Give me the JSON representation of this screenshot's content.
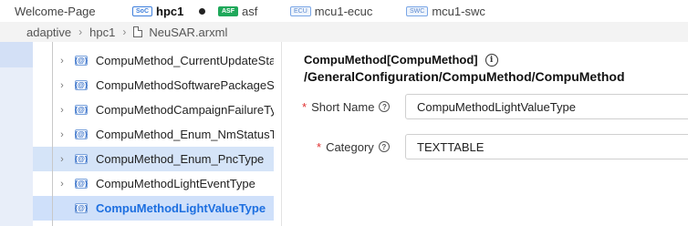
{
  "tabs": [
    {
      "label": "Welcome-Page",
      "badge": "",
      "active": false
    },
    {
      "label": "hpc1",
      "badge": "SoC",
      "active": true
    },
    {
      "label": "asf",
      "badge": "ASF",
      "active": false
    },
    {
      "label": "mcu1-ecuc",
      "badge": "ECU",
      "active": false
    },
    {
      "label": "mcu1-swc",
      "badge": "SWC",
      "active": false
    }
  ],
  "breadcrumb": {
    "items": [
      "adaptive",
      "hpc1",
      "NeuSAR.arxml"
    ]
  },
  "tree": {
    "node_icon": "{@}",
    "items": [
      {
        "label": "CompuMethod_CurrentUpdateSta"
      },
      {
        "label": "CompuMethodSoftwarePackageS"
      },
      {
        "label": "CompuMethodCampaignFailureTy"
      },
      {
        "label": "CompuMethod_Enum_NmStatusT"
      },
      {
        "label": "CompuMethod_Enum_PncType"
      },
      {
        "label": "CompuMethodLightEventType"
      },
      {
        "label": "CompuMethodLightValueType"
      }
    ]
  },
  "detail": {
    "title_line1": "CompuMethod[CompuMethod]",
    "title_line2": "/GeneralConfiguration/CompuMethod/CompuMethod",
    "fields": {
      "short_name": {
        "label": "Short Name",
        "value": "CompuMethodLightValueType",
        "required": "*"
      },
      "category": {
        "label": "Category",
        "value": "TEXTTABLE",
        "required": "*"
      }
    }
  },
  "colors": {
    "selected_text": "#1d6fe0",
    "row_highlight": "#d5e4f8",
    "required": "#e03030"
  }
}
